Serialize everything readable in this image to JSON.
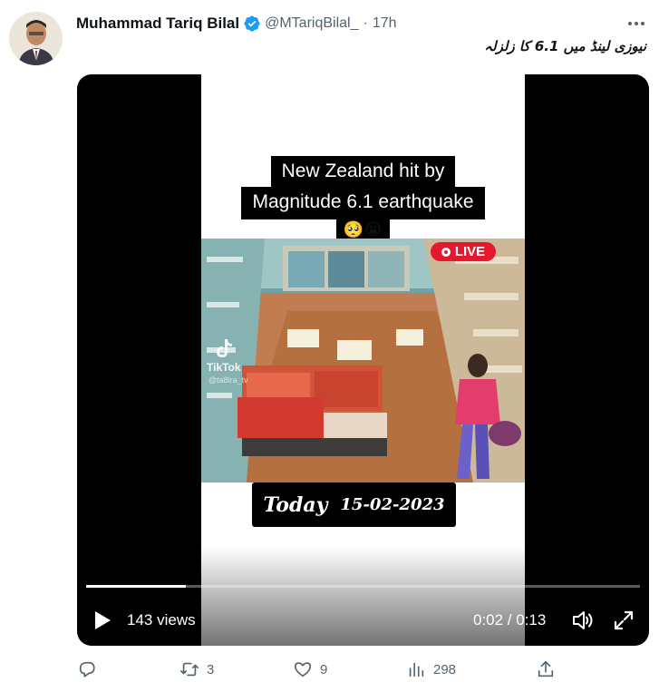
{
  "tweet": {
    "author_name": "Muhammad Tariq Bilal",
    "handle": "@MTariqBilal_",
    "separator": "·",
    "time": "17h",
    "text": "نیوزی لینڈ میں 6.1 کا زلزلہ"
  },
  "video": {
    "caption_line1": "New Zealand hit by",
    "caption_line2": "Magnitude 6.1 earthquake",
    "caption_emoji": "🥺😭",
    "live_badge": "LIVE",
    "watermark": "TikTok",
    "watermark_handle": "@ta8lra_tv",
    "date_word": "Today",
    "date_value": "15-02-2023",
    "views": "143 views",
    "timecode": "0:02 / 0:13",
    "progress_fraction": 0.18
  },
  "actions": {
    "reply_count": "",
    "retweet_count": "3",
    "like_count": "9",
    "views_count": "298"
  },
  "colors": {
    "verified_blue": "#1d9bf0",
    "muted_text": "#536471",
    "live_red": "#e5182f"
  },
  "icons": [
    "verified-badge-icon",
    "more-icon",
    "play-icon",
    "volume-icon",
    "fullscreen-icon",
    "reply-icon",
    "retweet-icon",
    "like-icon",
    "views-icon",
    "share-icon"
  ]
}
